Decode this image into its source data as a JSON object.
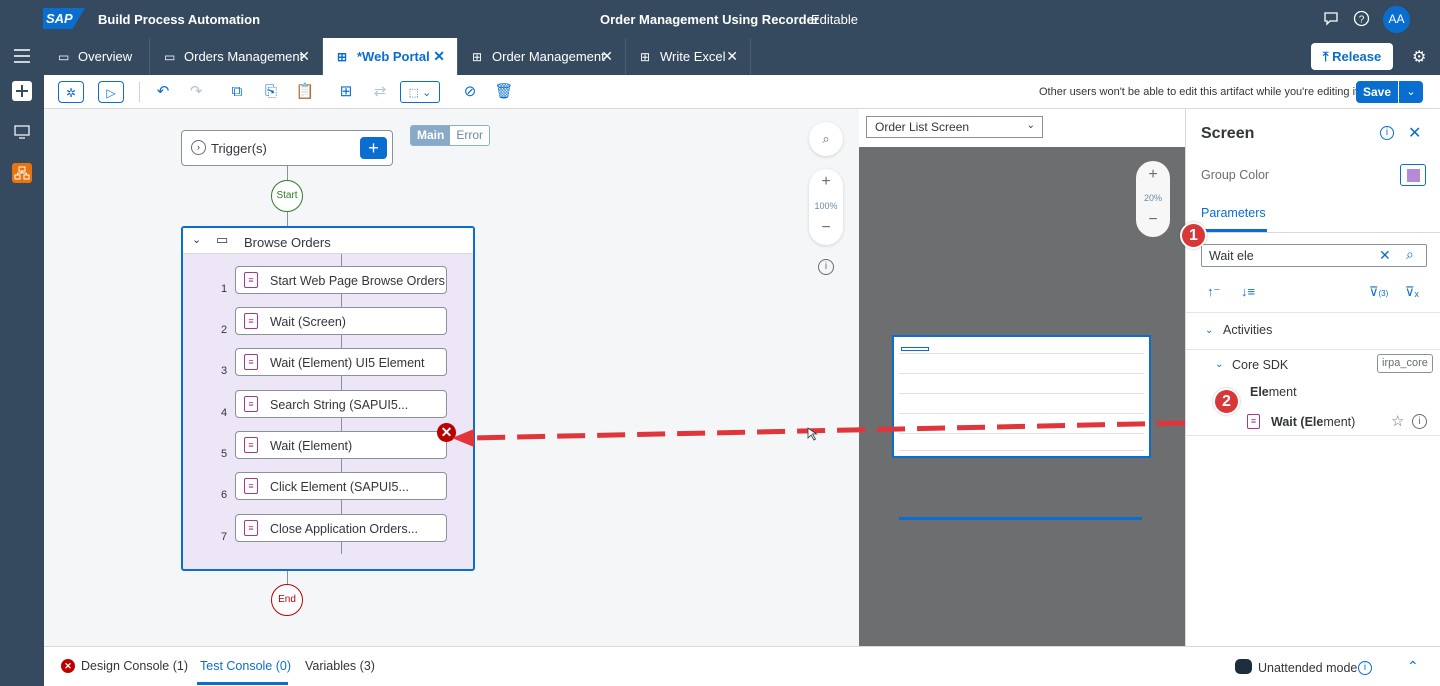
{
  "shell": {
    "logo": "SAP",
    "app_title": "Build Process Automation",
    "project_title": "Order Management Using Recorder",
    "status": "Editable",
    "avatar": "AA"
  },
  "tabs": [
    {
      "label": "Overview",
      "icon": "overview-icon"
    },
    {
      "label": "Orders Management",
      "icon": "screen-icon"
    },
    {
      "label": "*Web Portal",
      "icon": "automation-icon",
      "active": true
    },
    {
      "label": "Order Management",
      "icon": "automation-icon"
    },
    {
      "label": "Write Excel",
      "icon": "automation-icon"
    }
  ],
  "release_label": "Release",
  "toolbar": {
    "lock_message": "Other users won't be able to edit this artifact while you're editing it.",
    "save_label": "Save"
  },
  "canvas": {
    "trigger_label": "Trigger(s)",
    "segment": {
      "main": "Main",
      "error": "Error"
    },
    "start_label": "Start",
    "end_label": "End",
    "group_label": "Browse Orders",
    "zoom_level": "100%",
    "activities": [
      {
        "num": "1",
        "label": "Start Web Page Browse Orders"
      },
      {
        "num": "2",
        "label": "Wait (Screen)"
      },
      {
        "num": "3",
        "label": "Wait (Element) UI5 Element"
      },
      {
        "num": "4",
        "label": "Search String (SAPUI5..."
      },
      {
        "num": "5",
        "label": "Wait (Element)"
      },
      {
        "num": "6",
        "label": "Click Element (SAPUI5..."
      },
      {
        "num": "7",
        "label": "Close Application Orders..."
      }
    ]
  },
  "screen_pane": {
    "selected_screen": "Order List Screen",
    "zoom_level": "20%"
  },
  "right_panel": {
    "title": "Screen",
    "group_color_label": "Group Color",
    "group_color": "#b58ad6",
    "params_tab": "Parameters",
    "search_value": "Wait ele",
    "filter_count": "(3)",
    "tree": {
      "activities_label": "Activities",
      "core_sdk_label": "Core SDK",
      "core_sdk_badge": "irpa_core",
      "element_label_bold": "Ele",
      "element_label_rest": "ment",
      "wait_label_pre": "Wait (",
      "wait_label_bold": "Ele",
      "wait_label_post": "ment)"
    }
  },
  "callouts": {
    "one": "1",
    "two": "2"
  },
  "bottom": {
    "design_console": "Design Console (1)",
    "test_console": "Test Console (0)",
    "variables": "Variables (3)",
    "unattended": "Unattended mode"
  },
  "colors": {
    "shell": "#354a5f",
    "accent": "#0a6ed1",
    "error": "#bb0000",
    "arrow": "#e0353a"
  }
}
